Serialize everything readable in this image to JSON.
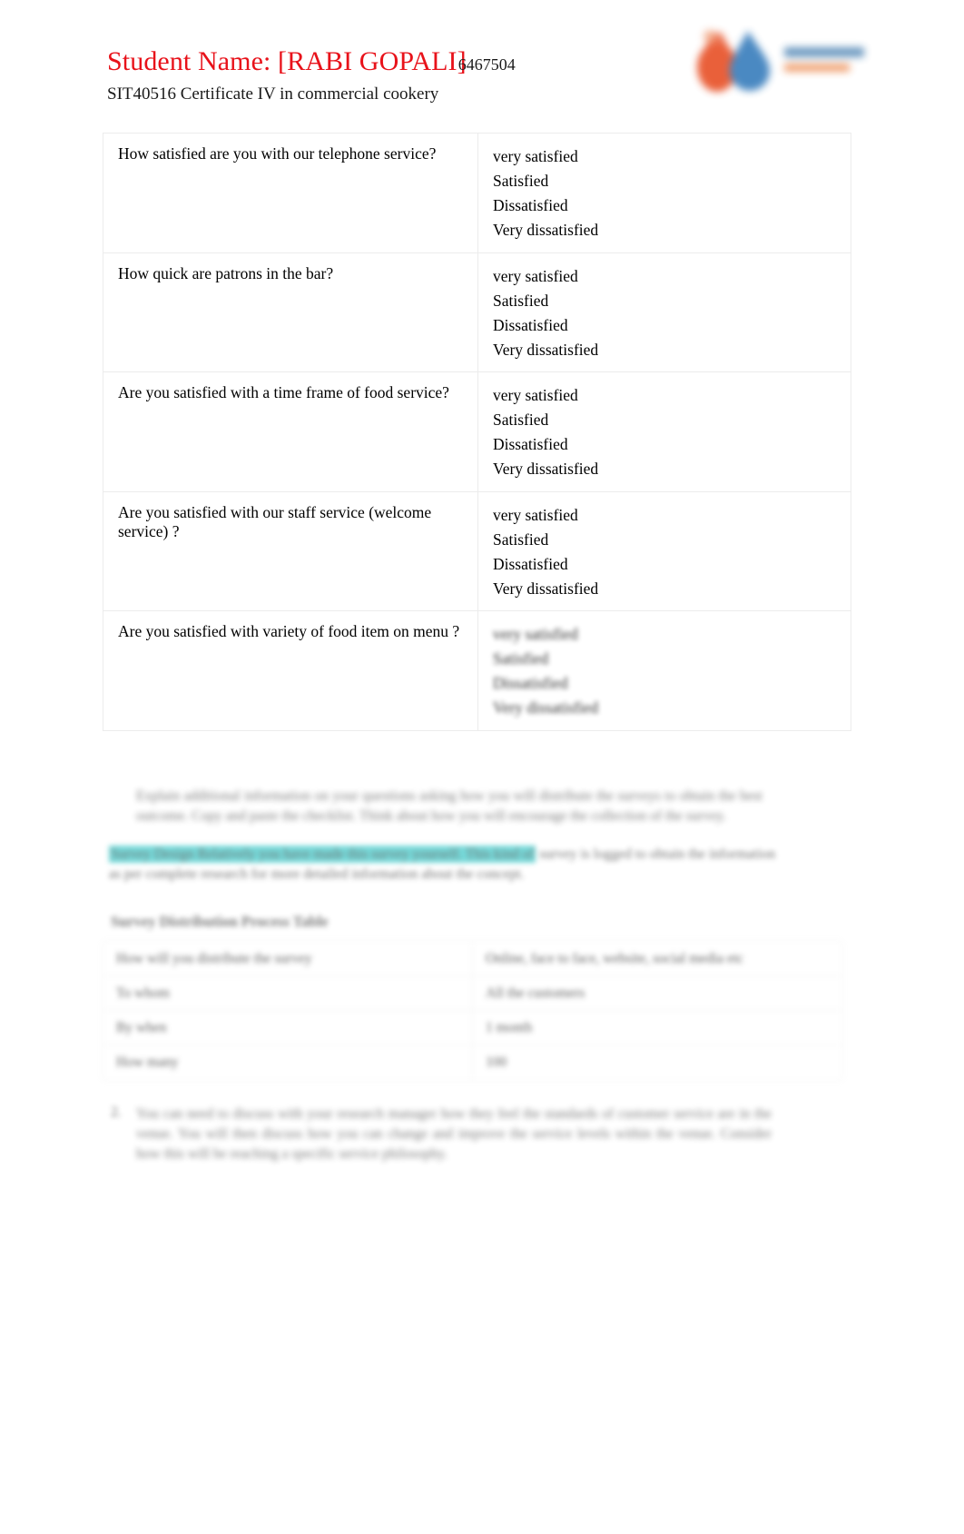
{
  "header": {
    "student_name_label": "Student Name: [RABI GOPALI]",
    "student_id": "6467504",
    "course": "SIT40516 Certificate IV in commercial cookery"
  },
  "logo": {
    "name": "institute-logo",
    "colors": {
      "orange": "#e8542a",
      "blue": "#3b7fbd",
      "text_blue": "#2e6ea6",
      "text_orange": "#e8702a"
    }
  },
  "colors": {
    "accent_red": "#e8121a",
    "highlight_cyan": "#2fc6c6",
    "table_border": "#ececec",
    "body_text": "#1a1a1a"
  },
  "survey_table": {
    "name": "customer-satisfaction-survey-table",
    "options": [
      "very satisfied",
      "Satisfied",
      "Dissatisfied",
      "Very dissatisfied"
    ],
    "rows": [
      {
        "question": "How satisfied are you with our telephone service?",
        "options": [
          "very satisfied",
          "Satisfied",
          "Dissatisfied",
          "Very dissatisfied"
        ],
        "blurred": false
      },
      {
        "question": "How quick are patrons in the bar?",
        "options": [
          "very satisfied",
          "Satisfied",
          "Dissatisfied",
          "Very dissatisfied"
        ],
        "blurred": false
      },
      {
        "question": "Are you satisfied with a time frame of food service?",
        "options": [
          "very satisfied",
          "Satisfied",
          "Dissatisfied",
          "Very dissatisfied"
        ],
        "blurred": false
      },
      {
        "question": "Are you satisfied with our staff service (welcome service) ?",
        "options": [
          "very satisfied",
          "Satisfied",
          "Dissatisfied",
          "Very dissatisfied"
        ],
        "blurred": false
      },
      {
        "question": "Are you satisfied with variety of food item on menu ?",
        "options": [
          "very satisfied",
          "Satisfied",
          "Dissatisfied",
          "Very dissatisfied"
        ],
        "blurred": true
      }
    ]
  },
  "paragraph_a": {
    "text": "Explain additional information on your questions asking how you will distribute the surveys to obtain the best outcome. Copy and paste the checklist. Think about how you will encourage the collection of the survey.",
    "legible": false
  },
  "paragraph_b": {
    "highlighted_text": "Survey Design Relatively you have made this survey yourself. This kind of",
    "trailing_text": "survey is logged to obtain the information as per complete research for more detailed information about the concept.",
    "legible": false
  },
  "dist_heading": {
    "text": "Survey Distribution Process Table",
    "legible": false
  },
  "dist_table": {
    "name": "survey-distribution-process-table",
    "rows": [
      {
        "label": "How will you distribute the survey",
        "value": "Online, face to face, website, social media etc"
      },
      {
        "label": "To whom",
        "value": "All the customers"
      },
      {
        "label": "By when",
        "value": "1 month"
      },
      {
        "label": "How many",
        "value": "100"
      }
    ],
    "legible": false
  },
  "paragraph_c": {
    "bullet": "2.",
    "text": "You can need to discuss with your research manager how they feel the standards of customer service are in the venue. You will then discuss how you can change and improve the service levels within the venue. Consider how this will be reaching a specific service philosophy.",
    "legible": false
  }
}
